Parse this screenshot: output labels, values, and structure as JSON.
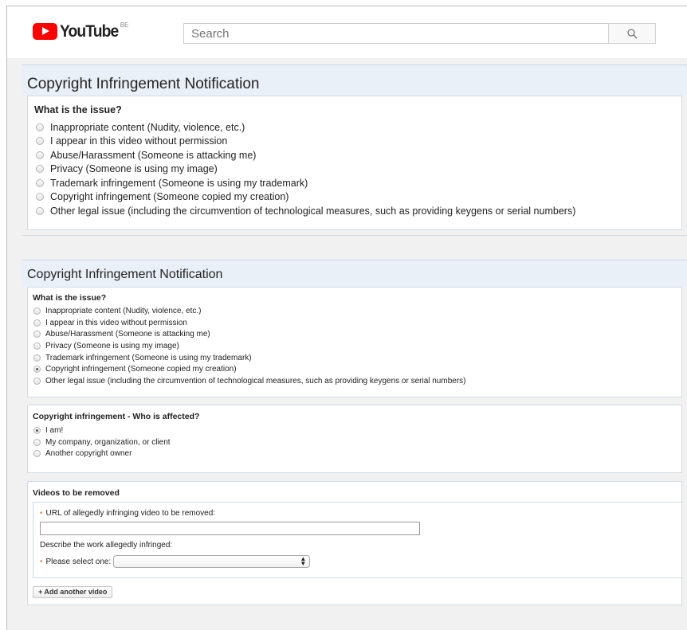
{
  "header": {
    "logo_text": "YouTube",
    "country_code": "BE",
    "search_placeholder": "Search"
  },
  "section1": {
    "title": "Copyright Infringement Notification",
    "question": "What is the issue?",
    "options": [
      "Inappropriate content (Nudity, violence, etc.)",
      "I appear in this video without permission",
      "Abuse/Harassment (Someone is attacking me)",
      "Privacy (Someone is using my image)",
      "Trademark infringement (Someone is using my trademark)",
      "Copyright infringement (Someone copied my creation)",
      "Other legal issue (including the circumvention of technological measures, such as providing keygens or serial numbers)"
    ]
  },
  "section2": {
    "title": "Copyright Infringement Notification",
    "question": "What is the issue?",
    "options": [
      "Inappropriate content (Nudity, violence, etc.)",
      "I appear in this video without permission",
      "Abuse/Harassment (Someone is attacking me)",
      "Privacy (Someone is using my image)",
      "Trademark infringement (Someone is using my trademark)",
      "Copyright infringement (Someone copied my creation)",
      "Other legal issue (including the circumvention of technological measures, such as providing keygens or serial numbers)"
    ],
    "selected_option": "Copyright infringement (Someone copied my creation)",
    "affected": {
      "question": "Copyright infringement - Who is affected?",
      "options": [
        "I am!",
        "My company, organization, or client",
        "Another copyright owner"
      ],
      "selected_option": "I am!"
    },
    "videos": {
      "heading": "Videos to be removed",
      "url_label": "URL of allegedly infringing video to be removed:",
      "url_value": "",
      "work_label": "Describe the work allegedly infringed:",
      "select_label": "Please select one:",
      "select_value": "",
      "add_button": "+ Add another video"
    }
  }
}
